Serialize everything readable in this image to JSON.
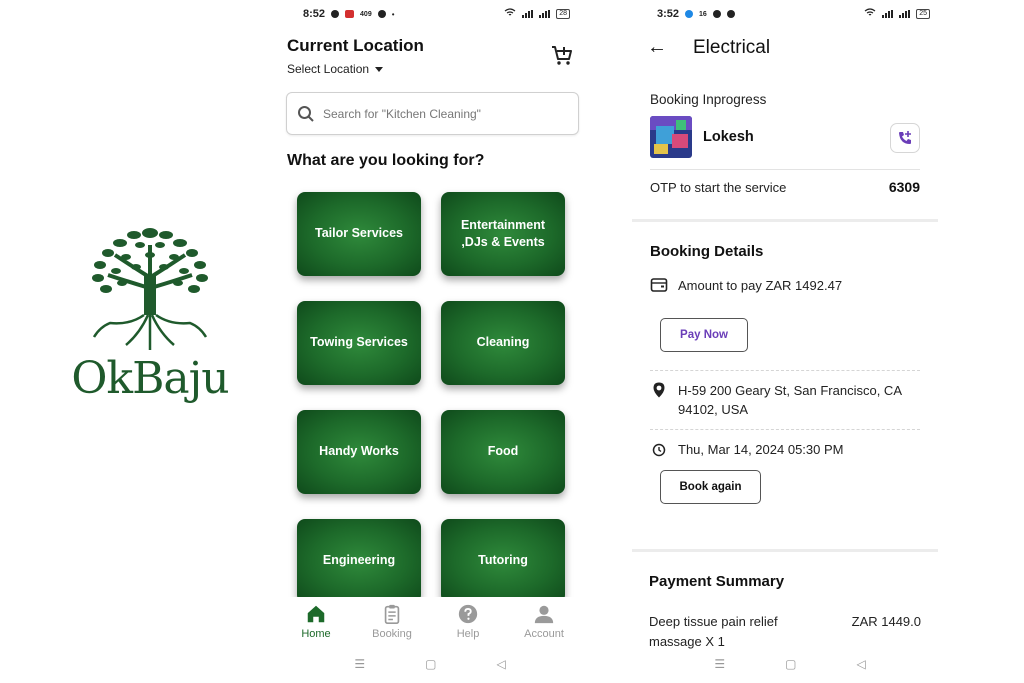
{
  "logo": {
    "text": "OkBaju",
    "color": "#1f5a2c"
  },
  "home": {
    "status_bar": {
      "time": "8:52",
      "badge": "409",
      "battery": "28"
    },
    "location_title": "Current Location",
    "location_select": "Select Location",
    "search_placeholder": "Search for \"Kitchen Cleaning\"",
    "section_title": "What are you looking for?",
    "services": [
      "Tailor Services",
      "Entertainment ,DJs & Events",
      "Towing Services",
      "Cleaning",
      "Handy Works",
      "Food",
      "Engineering",
      "Tutoring"
    ],
    "nav": [
      {
        "label": "Home",
        "icon": "home-icon",
        "active": true
      },
      {
        "label": "Booking",
        "icon": "clipboard-icon"
      },
      {
        "label": "Help",
        "icon": "help-icon"
      },
      {
        "label": "Account",
        "icon": "account-icon"
      }
    ],
    "accent": "#1d6a2a"
  },
  "booking": {
    "status_bar": {
      "time": "3:52",
      "badge": "16",
      "battery": "25"
    },
    "title": "Electrical",
    "status": "Booking Inprogress",
    "provider_name": "Lokesh",
    "otp_label": "OTP to start the service",
    "otp_value": "6309",
    "details_heading": "Booking Details",
    "amount_text": "Amount to pay ZAR 1492.47",
    "pay_now": "Pay Now",
    "address": "H-59 200 Geary St, San Francisco, CA 94102, USA",
    "datetime": "Thu, Mar 14, 2024 05:30 PM",
    "book_again": "Book again",
    "payment_heading": "Payment Summary",
    "item_label": "Deep tissue pain relief massage X 1",
    "item_price": "ZAR 1449.0",
    "accent": "#6a3db8"
  }
}
